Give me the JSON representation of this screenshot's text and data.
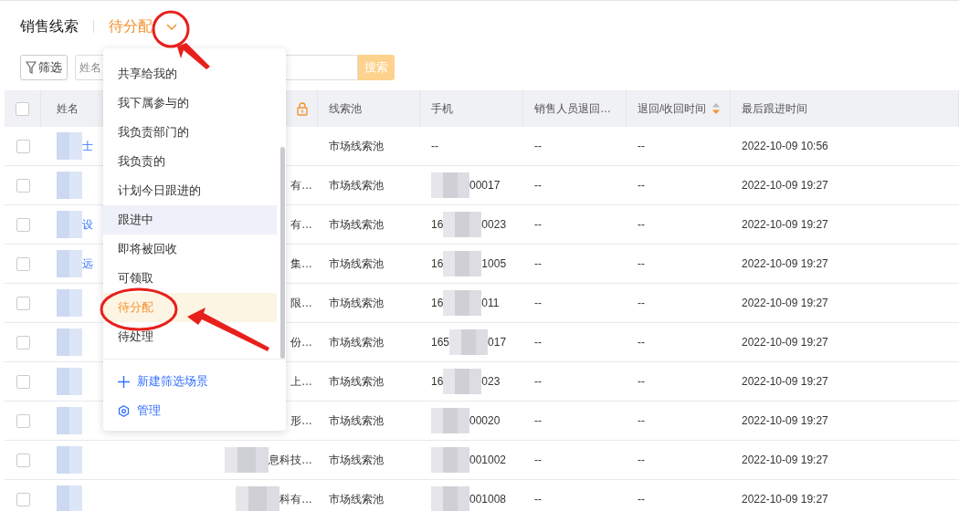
{
  "header": {
    "title": "销售线索",
    "scene": "待分配"
  },
  "toolbar": {
    "filter": "筛选",
    "search_placeholder": "姓名",
    "search_button": "搜索"
  },
  "table": {
    "header_checked": false,
    "columns": [
      {
        "kind": "text",
        "label": "姓名"
      },
      {
        "kind": "locked"
      },
      {
        "kind": "text",
        "label": "线索池"
      },
      {
        "kind": "text",
        "label": "手机"
      },
      {
        "kind": "text",
        "label": "销售人员退回…"
      },
      {
        "kind": "sort",
        "label": "退回/收回时间"
      },
      {
        "kind": "text",
        "label": "最后跟进时间"
      }
    ],
    "rows": [
      {
        "checked": false,
        "name": "士",
        "company": {},
        "pool": "市场线索池",
        "phone": {
          "text": "--"
        },
        "returner": "--",
        "return_time": "--",
        "last_follow": "2022-10-09 10:56"
      },
      {
        "checked": false,
        "company": {
          "text": "有…"
        },
        "pool": "市场线索池",
        "phone": {
          "suffix": "00017"
        },
        "returner": "--",
        "return_time": "--",
        "last_follow": "2022-10-09 19:27"
      },
      {
        "checked": false,
        "name": "设",
        "company": {
          "text": "有…"
        },
        "pool": "市场线索池",
        "phone": {
          "prefix": "16",
          "suffix": "0023"
        },
        "returner": "--",
        "return_time": "--",
        "last_follow": "2022-10-09 19:27"
      },
      {
        "checked": false,
        "name": "远",
        "company": {
          "text": "集…"
        },
        "pool": "市场线索池",
        "phone": {
          "prefix": "16",
          "suffix": "1005"
        },
        "returner": "--",
        "return_time": "--",
        "last_follow": "2022-10-09 19:27"
      },
      {
        "checked": false,
        "company": {
          "text": "限…"
        },
        "pool": "市场线索池",
        "phone": {
          "prefix": "16",
          "suffix": "011"
        },
        "returner": "--",
        "return_time": "--",
        "last_follow": "2022-10-09 19:27"
      },
      {
        "checked": false,
        "company": {
          "text": "份…"
        },
        "pool": "市场线索池",
        "phone": {
          "prefix": "165",
          "suffix": "017"
        },
        "returner": "--",
        "return_time": "--",
        "last_follow": "2022-10-09 19:27"
      },
      {
        "checked": false,
        "company": {
          "text": "上…"
        },
        "pool": "市场线索池",
        "phone": {
          "prefix": "16",
          "suffix": "023"
        },
        "returner": "--",
        "return_time": "--",
        "last_follow": "2022-10-09 19:27"
      },
      {
        "checked": false,
        "company": {
          "text": "形…"
        },
        "pool": "市场线索池",
        "phone": {
          "suffix": "00020"
        },
        "returner": "--",
        "return_time": "--",
        "last_follow": "2022-10-09 19:27"
      },
      {
        "checked": false,
        "company": {
          "text": "息科技…",
          "masked": true
        },
        "pool": "市场线索池",
        "phone": {
          "suffix": "001002"
        },
        "returner": "--",
        "return_time": "--",
        "last_follow": "2022-10-09 19:27"
      },
      {
        "checked": false,
        "company": {
          "text": "科有…",
          "masked": true
        },
        "pool": "市场线索池",
        "phone": {
          "suffix": "001008"
        },
        "returner": "--",
        "return_time": "--",
        "last_follow": "2022-10-09 19:27"
      }
    ]
  },
  "scene_menu": {
    "items": [
      {
        "label": "共享给我的",
        "selected": false,
        "hovered": false
      },
      {
        "label": "我下属参与的",
        "selected": false,
        "hovered": false
      },
      {
        "label": "我负责部门的",
        "selected": false,
        "hovered": false
      },
      {
        "label": "我负责的",
        "selected": false,
        "hovered": false
      },
      {
        "label": "计划今日跟进的",
        "selected": false,
        "hovered": false
      },
      {
        "label": "跟进中",
        "selected": false,
        "hovered": true
      },
      {
        "label": "即将被回收",
        "selected": false,
        "hovered": false
      },
      {
        "label": "可领取",
        "selected": false,
        "hovered": false
      },
      {
        "label": "待分配",
        "selected": true,
        "hovered": false
      },
      {
        "label": "待处理",
        "selected": false,
        "hovered": false
      }
    ],
    "actions": [
      {
        "kind": "add",
        "label": "新建筛选场景"
      },
      {
        "kind": "manage",
        "label": "管理"
      }
    ]
  }
}
